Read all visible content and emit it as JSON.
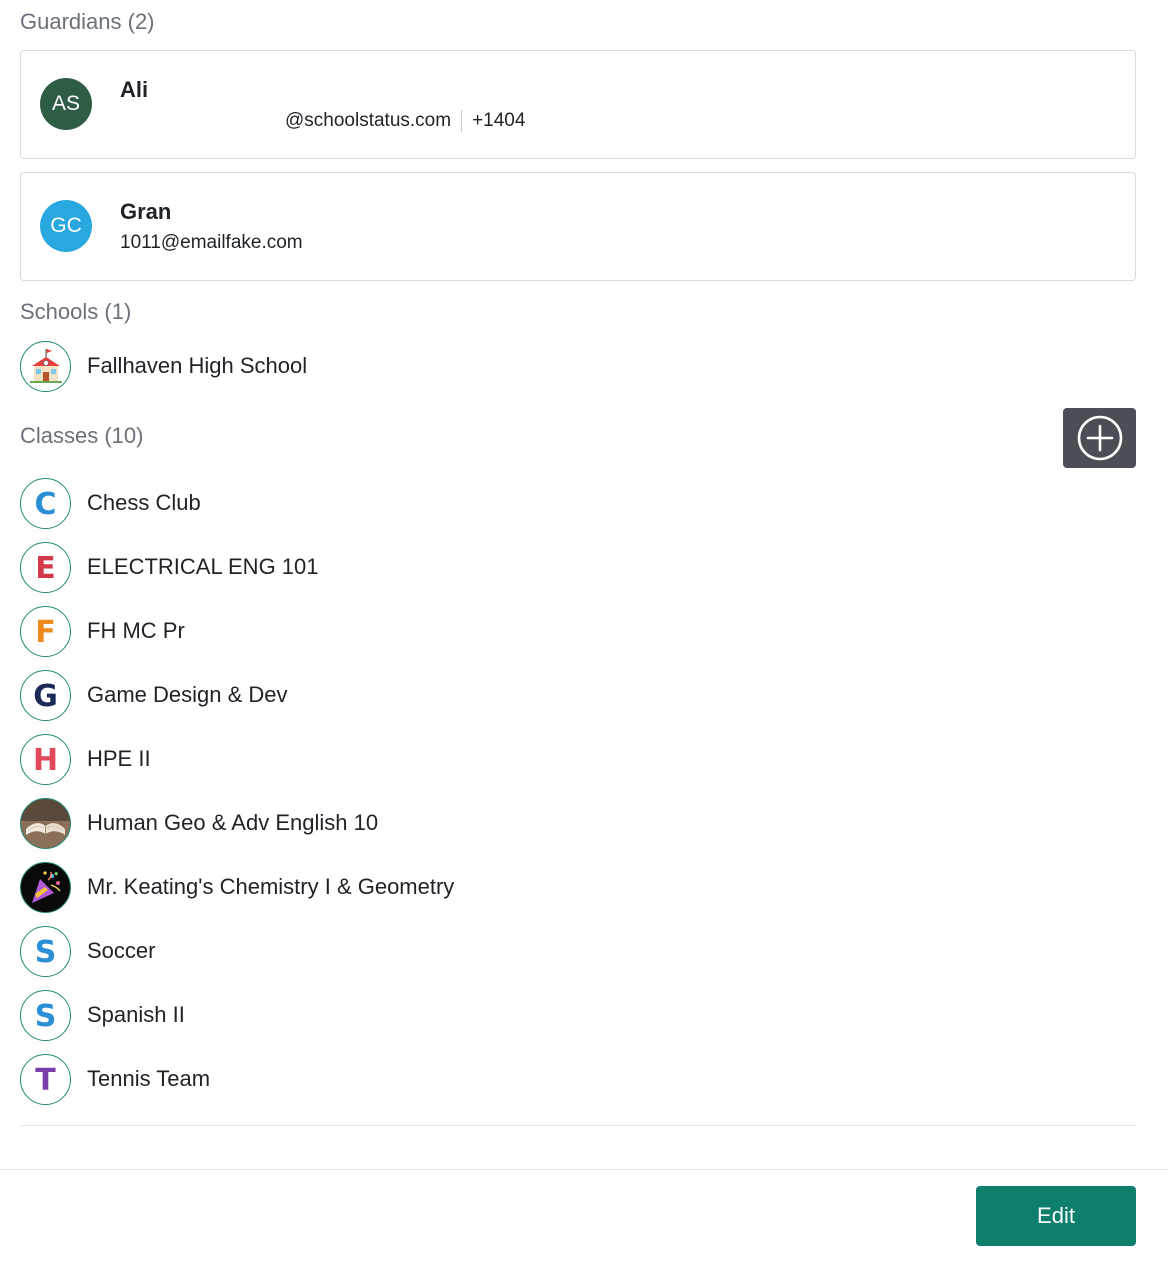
{
  "guardians": {
    "title": "Guardians (2)",
    "items": [
      {
        "initials": "AS",
        "name": "Ali",
        "email": "@schoolstatus.com",
        "phone": "+1404",
        "avatar_color": "#2e5c45"
      },
      {
        "initials": "GC",
        "name": "Gran",
        "email": "1011@emailfake.com",
        "phone": "",
        "avatar_color": "#29a8e0"
      }
    ]
  },
  "schools": {
    "title": "Schools (1)",
    "items": [
      {
        "name": "Fallhaven High School",
        "icon": "school-building-icon"
      }
    ]
  },
  "classes": {
    "title": "Classes (10)",
    "add_icon": "plus-circle-icon",
    "items": [
      {
        "name": "Chess Club",
        "letter": "C",
        "letter_color": "#2a8fd4"
      },
      {
        "name": "ELECTRICAL ENG 101",
        "letter": "E",
        "letter_color": "#d23a4a"
      },
      {
        "name": "FH MC Pr",
        "letter": "F",
        "letter_color": "#ee8a1c"
      },
      {
        "name": "Game Design & Dev",
        "letter": "G",
        "letter_color": "#1b2a57"
      },
      {
        "name": "HPE II",
        "letter": "H",
        "letter_color": "#e24a5c"
      },
      {
        "name": "Human Geo & Adv English 10",
        "icon": "open-book-icon"
      },
      {
        "name": "Mr. Keating's Chemistry I & Geometry",
        "icon": "party-popper-icon"
      },
      {
        "name": "Soccer",
        "letter": "S",
        "letter_color": "#2a8fd4"
      },
      {
        "name": "Spanish II",
        "letter": "S",
        "letter_color": "#2a8fd4"
      },
      {
        "name": "Tennis Team",
        "letter": "T",
        "letter_color": "#7a3fa8"
      }
    ]
  },
  "footer": {
    "edit_label": "Edit",
    "edit_color": "#0f7f6d"
  }
}
